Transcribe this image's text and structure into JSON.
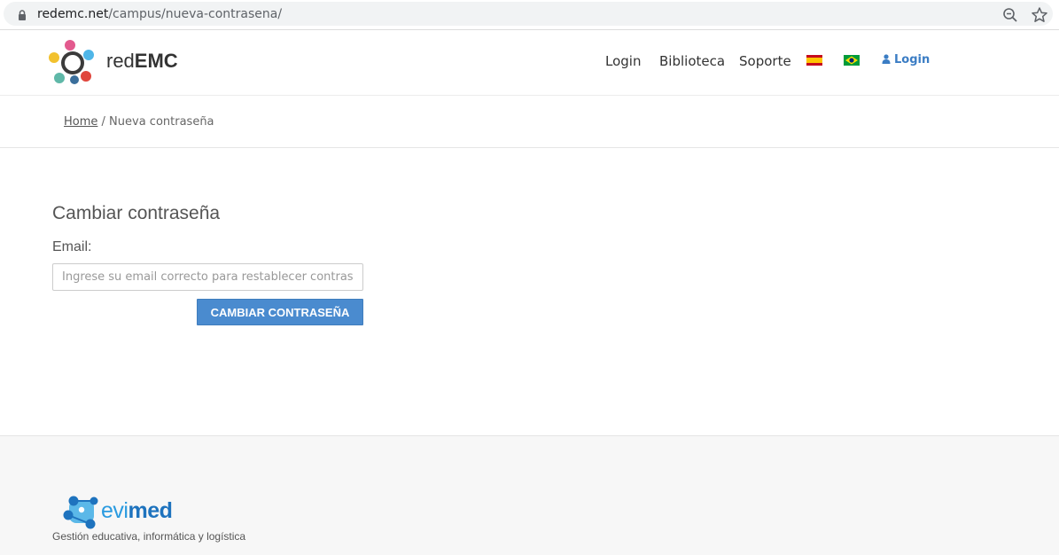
{
  "browser": {
    "url_host": "redemc.net",
    "url_path": "/campus/nueva-contrasena/"
  },
  "header": {
    "brand_prefix": "red",
    "brand_bold": "EMC",
    "nav": {
      "login": "Login",
      "library": "Biblioteca",
      "support": "Soporte",
      "user_login": "Login"
    },
    "colors": {
      "link_accent": "#3b7dc4"
    }
  },
  "breadcrumb": {
    "home": "Home",
    "separator": " / ",
    "current": "Nueva contraseña"
  },
  "form": {
    "title": "Cambiar contraseña",
    "email_label": "Email:",
    "email_value": "",
    "email_placeholder": "Ingrese su email correcto para restablecer contraseña",
    "submit_label": "CAMBIAR CONTRASEÑA",
    "colors": {
      "button": "#4a8bcf"
    }
  },
  "footer": {
    "logo_evi": "evi",
    "logo_med": "med",
    "tagline": "Gestión educativa, informática y logística"
  }
}
